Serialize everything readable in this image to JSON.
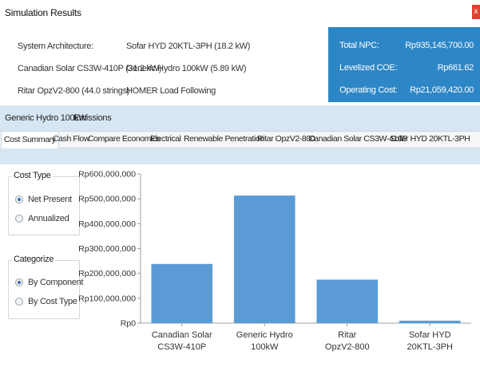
{
  "window": {
    "title": "Simulation Results",
    "close_label": "x"
  },
  "architecture": {
    "rows": [
      [
        "System Architecture:",
        "Sofar HYD 20KTL-3PH (18.2 kW)"
      ],
      [
        "Canadian Solar CS3W-410P (31.2 kW)",
        "Generic Hydro 100kW (5.89 kW)"
      ],
      [
        "Ritar OpzV2-800 (44.0 strings)",
        "HOMER Load Following"
      ]
    ]
  },
  "summary": {
    "rows": [
      {
        "label": "Total NPC:",
        "value": "Rp935,145,700.00"
      },
      {
        "label": "Levelized COE:",
        "value": "Rp661.62"
      },
      {
        "label": "Operating Cost:",
        "value": "Rp21,059,420.00"
      }
    ]
  },
  "sub_tabs": [
    "Generic Hydro 100kW",
    "Emissions"
  ],
  "tabs": [
    "Cost Summary",
    "Cash Flow",
    "Compare Economics",
    "Electrical",
    "Renewable Penetration",
    "Ritar OpzV2-800",
    "Canadian Solar CS3W-410P",
    "Sofar HYD 20KTL-3PH"
  ],
  "cost_type": {
    "title": "Cost Type",
    "options": [
      "Net Present",
      "Annualized"
    ],
    "selected": "Net Present"
  },
  "categorize": {
    "title": "Categorize",
    "options": [
      "By Component",
      "By Cost Type"
    ],
    "selected": "By Component"
  },
  "colors": {
    "bar": "#5b9bd5",
    "accent": "#2d86c6"
  },
  "chart_data": {
    "type": "bar",
    "categories": [
      [
        "Canadian Solar",
        "CS3W-410P"
      ],
      [
        "Generic Hydro",
        "100kW"
      ],
      [
        "Ritar",
        "OpzV2-800"
      ],
      [
        "Sofar HYD",
        "20KTL-3PH"
      ]
    ],
    "values": [
      238000000,
      513000000,
      175000000,
      10000000
    ],
    "ylim": [
      0,
      600000000
    ],
    "y_ticks": [
      0,
      100000000,
      200000000,
      300000000,
      400000000,
      500000000,
      600000000
    ],
    "y_tick_labels": [
      "Rp0",
      "Rp100,000,000",
      "Rp200,000,000",
      "Rp300,000,000",
      "Rp400,000,000",
      "Rp500,000,000",
      "Rp600,000,000"
    ],
    "grid": false
  }
}
